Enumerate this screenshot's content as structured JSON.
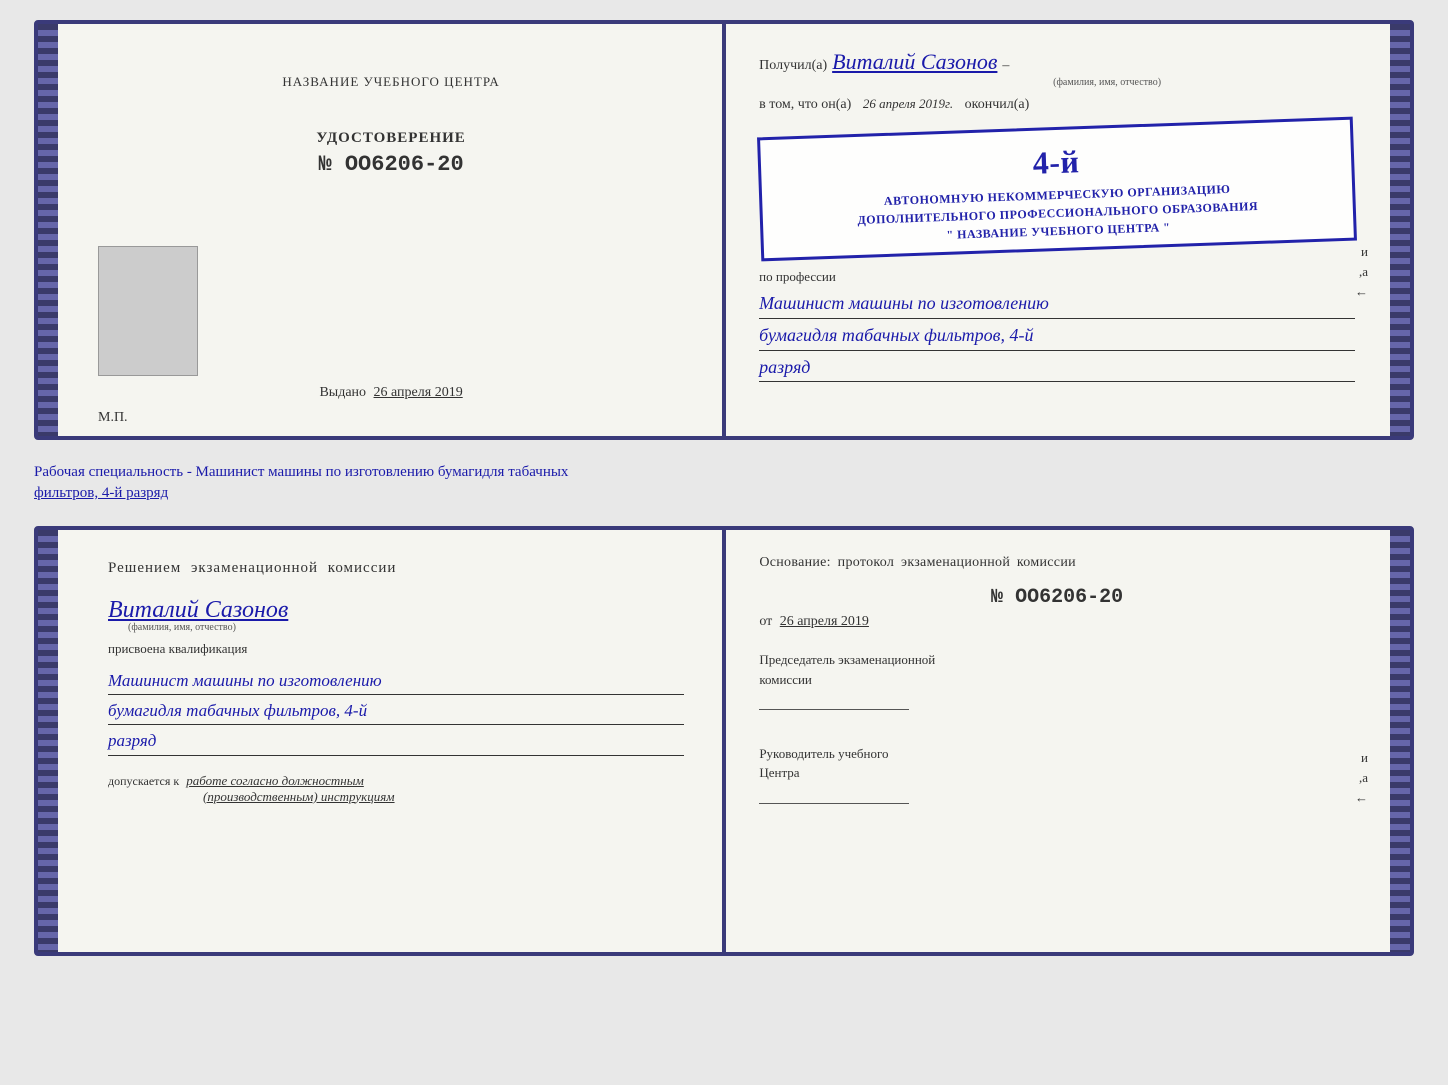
{
  "topDoc": {
    "left": {
      "trainingCenterLabel": "НАЗВАНИЕ УЧЕБНОГО ЦЕНТРА",
      "udostoverenie": "УДОСТОВЕРЕНИЕ",
      "number": "№ ОО6206-20",
      "vydano": "Выдано",
      "vydanoDate": "26 апреля 2019",
      "mp": "М.П."
    },
    "right": {
      "poluchilPrefix": "Получил(а)",
      "name": "Виталий Сазонов",
      "nameSub": "(фамилия, имя, отчество)",
      "dash1": "–",
      "vtomPrefix": "в том, что он(а)",
      "vtomDate": "26 апреля 2019г.",
      "okonchil": "окончил(а)",
      "stampLine1": "АВТОНОМНУЮ НЕКОММЕРЧЕСКУЮ ОРГАНИЗАЦИЮ",
      "stampLine2": "ДОПОЛНИТЕЛЬНОГО ПРОФЕССИОНАЛЬНОГО ОБРАЗОВАНИЯ",
      "stampLine3": "\" НАЗВАНИЕ УЧЕБНОГО ЦЕНТРА \"",
      "stampNumber": "4-й",
      "poProfessii": "по профессии",
      "profLine1": "Машинист машины по изготовлению",
      "profLine2": "бумагидля табачных фильтров, 4-й",
      "profLine3": "разряд"
    }
  },
  "betweenText": {
    "line1": "Рабочая специальность - Машинист машины по изготовлению бумагидля табачных",
    "line2": "фильтров, 4-й разряд"
  },
  "bottomDoc": {
    "left": {
      "komissiaTitle": "Решением  экзаменационной  комиссии",
      "name": "Виталий Сазонов",
      "nameSub": "(фамилия, имя, отчество)",
      "prisvoena": "присвоена квалификация",
      "qualLine1": "Машинист машины по изготовлению",
      "qualLine2": "бумагидля табачных фильтров, 4-й",
      "qualLine3": "разряд",
      "dopuskPrefix": "допускается к",
      "dopuskText": "работе согласно должностным",
      "dopuskText2": "(производственным) инструкциям"
    },
    "right": {
      "osnovanie": "Основание: протокол экзаменационной  комиссии",
      "number": "№  ОО6206-20",
      "otPrefix": "от",
      "otDate": "26 апреля 2019",
      "predsedatel": "Председатель экзаменационной",
      "predsedatelLine2": "комиссии",
      "rukovoditel": "Руководитель учебного",
      "rukovoditelLine2": "Центра"
    }
  }
}
